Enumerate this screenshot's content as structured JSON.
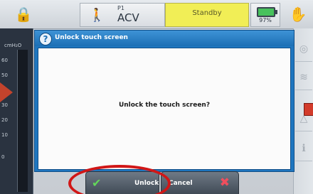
{
  "status_bar": {
    "patient": "P1",
    "mode": "ACV",
    "state": "Standby",
    "battery_percent": "97%",
    "battery_level": 0.97
  },
  "pressure_gauge": {
    "unit": "cmH₂O",
    "ticks": [
      "60",
      "50",
      "40",
      "30",
      "20",
      "10",
      "0"
    ]
  },
  "dialog": {
    "title": "Unlock touch screen",
    "message": "Unlock the touch screen?"
  },
  "buttons": {
    "unlock_label": "Unlock",
    "cancel_label": "Cancel"
  },
  "colors": {
    "standby": "#f1ee56",
    "dialog_header": "#1f76bf",
    "highlight": "#d11717",
    "arrow": "#c3432c"
  },
  "icons": [
    "lock-icon",
    "patient-icon",
    "battery-icon",
    "hand-icon",
    "question-icon",
    "check-icon",
    "x-icon",
    "circuit-icon",
    "alarm-icon",
    "info-icon"
  ]
}
